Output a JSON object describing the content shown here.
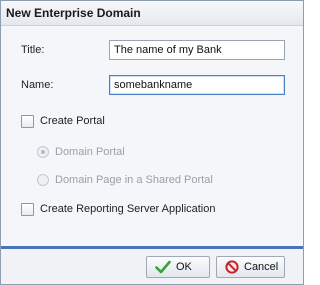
{
  "dialog": {
    "title": "New Enterprise Domain"
  },
  "form": {
    "title_label": "Title:",
    "title_value": "The name of my Bank",
    "name_label": "Name:",
    "name_value": "somebankname",
    "create_portal_label": "Create Portal",
    "domain_portal_label": "Domain Portal",
    "domain_page_label": "Domain Page in a Shared Portal",
    "create_reporting_label": "Create Reporting Server Application"
  },
  "buttons": {
    "ok_label": "OK",
    "cancel_label": "Cancel"
  },
  "icons": {
    "ok": "checkmark-icon",
    "cancel": "no-entry-icon"
  },
  "colors": {
    "accent": "#4b76b5",
    "ok_icon": "#3aa23a",
    "cancel_icon": "#c0262c"
  }
}
